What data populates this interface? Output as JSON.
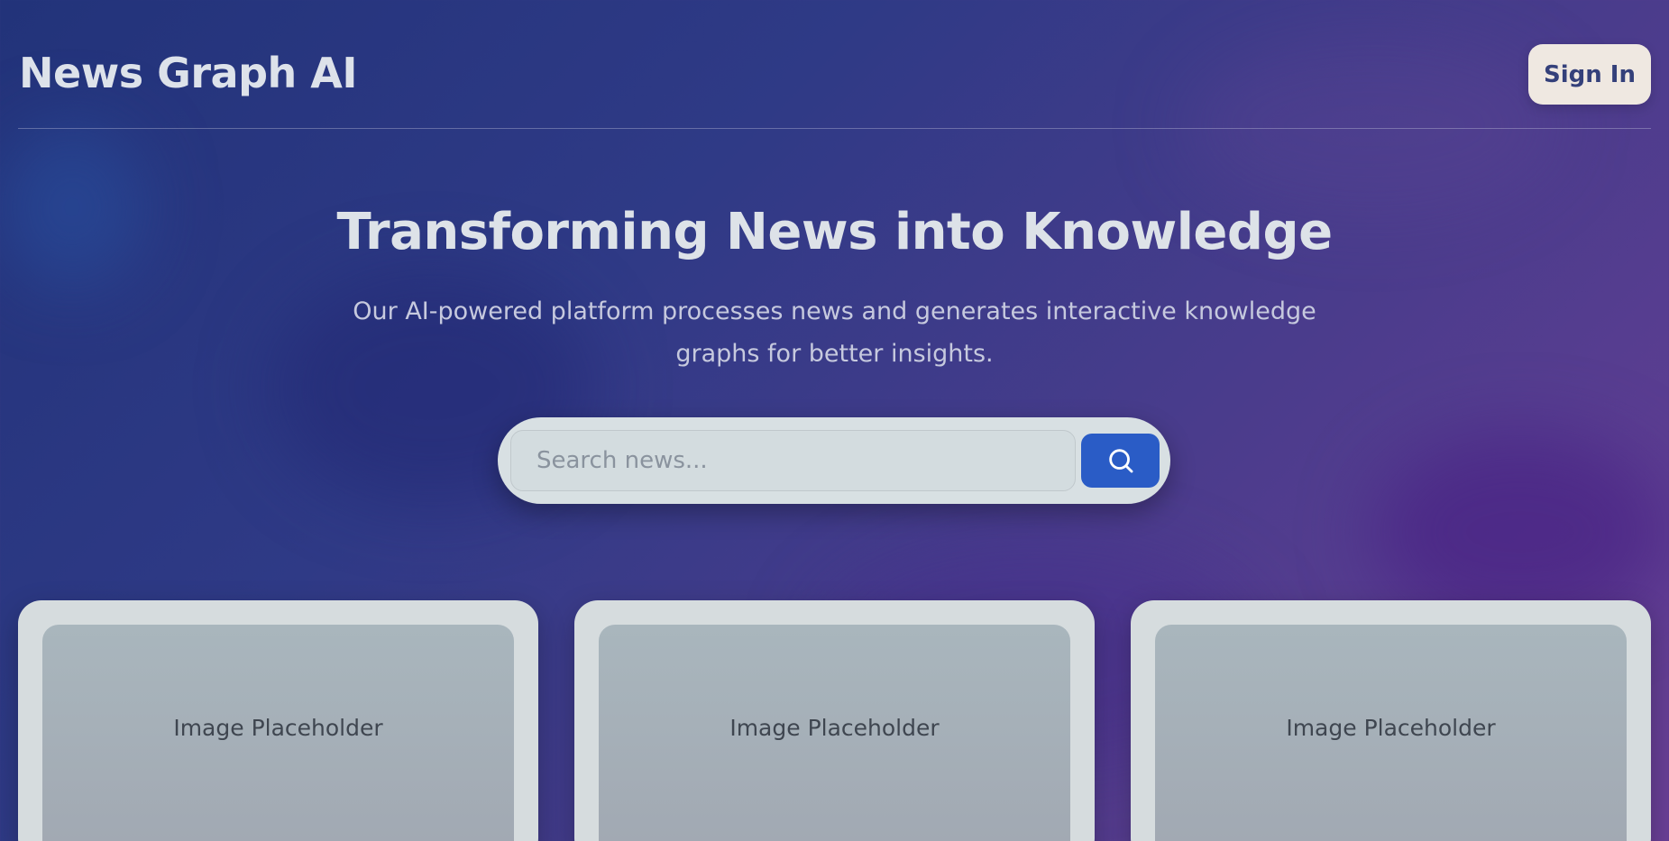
{
  "header": {
    "brand": "News Graph AI",
    "sign_in_label": "Sign In"
  },
  "hero": {
    "title": "Transforming News into Knowledge",
    "subtitle": "Our AI-powered platform processes news and generates interactive knowledge graphs for better insights."
  },
  "search": {
    "placeholder": "Search news...",
    "value": "",
    "button_icon": "search-icon"
  },
  "cards": [
    {
      "image_label": "Image Placeholder"
    },
    {
      "image_label": "Image Placeholder"
    },
    {
      "image_label": "Image Placeholder"
    }
  ],
  "colors": {
    "accent": "#2a5cc6",
    "signin_bg": "#efe8e1",
    "signin_text": "#34407a"
  }
}
